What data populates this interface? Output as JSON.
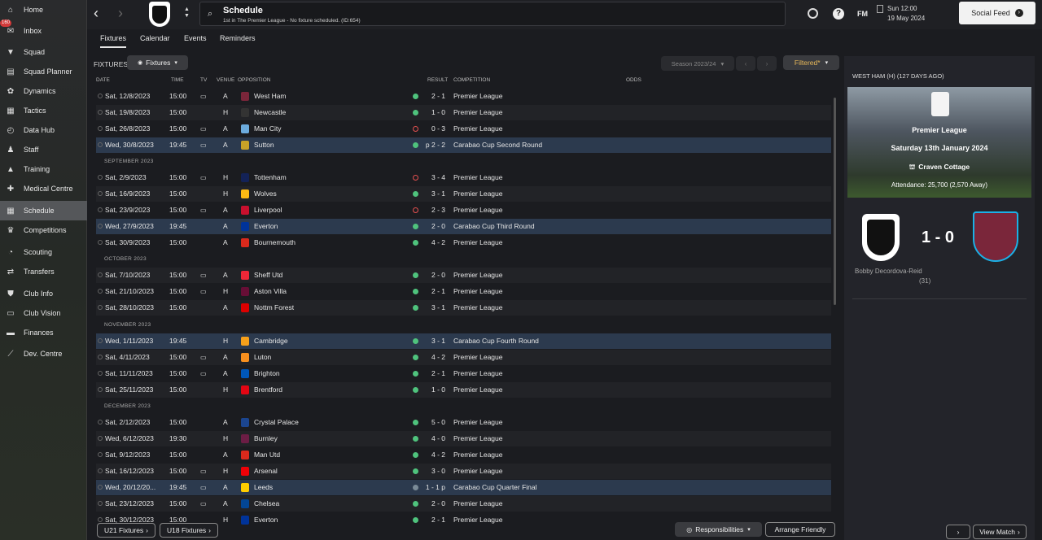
{
  "nav": [
    {
      "label": "Home",
      "icon": "home-icon"
    },
    {
      "label": "Inbox",
      "icon": "inbox-icon",
      "badge": "160"
    },
    {
      "label": "Squad",
      "icon": "shirt-icon"
    },
    {
      "label": "Squad Planner",
      "icon": "clipboard-icon"
    },
    {
      "label": "Dynamics",
      "icon": "dynamics-icon"
    },
    {
      "label": "Tactics",
      "icon": "tactics-icon"
    },
    {
      "label": "Data Hub",
      "icon": "data-hub-icon"
    },
    {
      "label": "Staff",
      "icon": "staff-icon"
    },
    {
      "label": "Training",
      "icon": "training-icon"
    },
    {
      "label": "Medical Centre",
      "icon": "medical-icon"
    },
    {
      "label": "Schedule",
      "icon": "calendar-icon",
      "active": true
    },
    {
      "label": "Competitions",
      "icon": "trophy-icon"
    },
    {
      "label": "Scouting",
      "icon": "scouting-icon"
    },
    {
      "label": "Transfers",
      "icon": "transfers-icon"
    },
    {
      "label": "Club Info",
      "icon": "shield-icon"
    },
    {
      "label": "Club Vision",
      "icon": "vision-icon"
    },
    {
      "label": "Finances",
      "icon": "finances-icon"
    },
    {
      "label": "Dev. Centre",
      "icon": "dev-centre-icon"
    }
  ],
  "header": {
    "title": "Schedule",
    "subtitle": "1st in The Premier League - No fixture scheduled. (ID:654)",
    "date": "Sun 12:00",
    "date2": "19 May 2024",
    "social_feed": "Social Feed",
    "fm_label": "FM"
  },
  "tabs": [
    "Fixtures",
    "Calendar",
    "Events",
    "Reminders"
  ],
  "toolbar": {
    "fixtures_label": "FIXTURES",
    "view_select": "Fixtures",
    "season": "Season 2023/24",
    "filter": "Filtered*"
  },
  "columns": {
    "date": "DATE",
    "time": "TIME",
    "tv": "TV",
    "venue": "VENUE",
    "opposition": "OPPOSITION",
    "result": "RESULT",
    "competition": "COMPETITION",
    "odds": "ODDS"
  },
  "months": [
    "SEPTEMBER 2023",
    "OCTOBER 2023",
    "NOVEMBER 2023",
    "DECEMBER 2023"
  ],
  "fixtures": [
    {
      "date": "Sat, 12/8/2023",
      "time": "15:00",
      "tv": true,
      "venue": "A",
      "opp": "West Ham",
      "res": "win",
      "score": "2 - 1",
      "comp": "Premier League",
      "crest": "#7a263a"
    },
    {
      "date": "Sat, 19/8/2023",
      "time": "15:00",
      "tv": false,
      "venue": "H",
      "opp": "Newcastle",
      "res": "win",
      "score": "1 - 0",
      "comp": "Premier League",
      "crest": "#333"
    },
    {
      "date": "Sat, 26/8/2023",
      "time": "15:00",
      "tv": true,
      "venue": "A",
      "opp": "Man City",
      "res": "loss",
      "score": "0 - 3",
      "comp": "Premier League",
      "crest": "#6cabdd"
    },
    {
      "date": "Wed, 30/8/2023",
      "time": "19:45",
      "tv": true,
      "venue": "A",
      "opp": "Sutton",
      "res": "win",
      "score": "p 2 - 2",
      "comp": "Carabao Cup Second Round",
      "crest": "#c9a227",
      "cup": true
    },
    {
      "date": "Sat, 2/9/2023",
      "time": "15:00",
      "tv": true,
      "venue": "H",
      "opp": "Tottenham",
      "res": "loss",
      "score": "3 - 4",
      "comp": "Premier League",
      "crest": "#132257"
    },
    {
      "date": "Sat, 16/9/2023",
      "time": "15:00",
      "tv": false,
      "venue": "H",
      "opp": "Wolves",
      "res": "win",
      "score": "3 - 1",
      "comp": "Premier League",
      "crest": "#fdb913"
    },
    {
      "date": "Sat, 23/9/2023",
      "time": "15:00",
      "tv": true,
      "venue": "A",
      "opp": "Liverpool",
      "res": "loss",
      "score": "2 - 3",
      "comp": "Premier League",
      "crest": "#c8102e"
    },
    {
      "date": "Wed, 27/9/2023",
      "time": "19:45",
      "tv": false,
      "venue": "A",
      "opp": "Everton",
      "res": "win",
      "score": "2 - 0",
      "comp": "Carabao Cup Third Round",
      "crest": "#003399",
      "cup": true
    },
    {
      "date": "Sat, 30/9/2023",
      "time": "15:00",
      "tv": false,
      "venue": "A",
      "opp": "Bournemouth",
      "res": "win",
      "score": "4 - 2",
      "comp": "Premier League",
      "crest": "#da291c"
    },
    {
      "date": "Sat, 7/10/2023",
      "time": "15:00",
      "tv": true,
      "venue": "A",
      "opp": "Sheff Utd",
      "res": "win",
      "score": "2 - 0",
      "comp": "Premier League",
      "crest": "#ee2737"
    },
    {
      "date": "Sat, 21/10/2023",
      "time": "15:00",
      "tv": true,
      "venue": "H",
      "opp": "Aston Villa",
      "res": "win",
      "score": "2 - 1",
      "comp": "Premier League",
      "crest": "#670e36"
    },
    {
      "date": "Sat, 28/10/2023",
      "time": "15:00",
      "tv": false,
      "venue": "A",
      "opp": "Nottm Forest",
      "res": "win",
      "score": "3 - 1",
      "comp": "Premier League",
      "crest": "#dd0000"
    },
    {
      "date": "Wed, 1/11/2023",
      "time": "19:45",
      "tv": false,
      "venue": "H",
      "opp": "Cambridge",
      "res": "win",
      "score": "3 - 1",
      "comp": "Carabao Cup Fourth Round",
      "crest": "#f6a01a",
      "cup": true
    },
    {
      "date": "Sat, 4/11/2023",
      "time": "15:00",
      "tv": true,
      "venue": "A",
      "opp": "Luton",
      "res": "win",
      "score": "4 - 2",
      "comp": "Premier League",
      "crest": "#f78f1e"
    },
    {
      "date": "Sat, 11/11/2023",
      "time": "15:00",
      "tv": true,
      "venue": "A",
      "opp": "Brighton",
      "res": "win",
      "score": "2 - 1",
      "comp": "Premier League",
      "crest": "#0057b8"
    },
    {
      "date": "Sat, 25/11/2023",
      "time": "15:00",
      "tv": false,
      "venue": "H",
      "opp": "Brentford",
      "res": "win",
      "score": "1 - 0",
      "comp": "Premier League",
      "crest": "#e30613"
    },
    {
      "date": "Sat, 2/12/2023",
      "time": "15:00",
      "tv": false,
      "venue": "A",
      "opp": "Crystal Palace",
      "res": "win",
      "score": "5 - 0",
      "comp": "Premier League",
      "crest": "#1b458f"
    },
    {
      "date": "Wed, 6/12/2023",
      "time": "19:30",
      "tv": false,
      "venue": "H",
      "opp": "Burnley",
      "res": "win",
      "score": "4 - 0",
      "comp": "Premier League",
      "crest": "#6c1d45"
    },
    {
      "date": "Sat, 9/12/2023",
      "time": "15:00",
      "tv": false,
      "venue": "A",
      "opp": "Man Utd",
      "res": "win",
      "score": "4 - 2",
      "comp": "Premier League",
      "crest": "#da291c"
    },
    {
      "date": "Sat, 16/12/2023",
      "time": "15:00",
      "tv": true,
      "venue": "H",
      "opp": "Arsenal",
      "res": "win",
      "score": "3 - 0",
      "comp": "Premier League",
      "crest": "#ef0107"
    },
    {
      "date": "Wed, 20/12/20...",
      "time": "19:45",
      "tv": true,
      "venue": "A",
      "opp": "Leeds",
      "res": "draw",
      "score": "1 - 1 p",
      "comp": "Carabao Cup Quarter Final",
      "crest": "#ffcd00",
      "cup": true
    },
    {
      "date": "Sat, 23/12/2023",
      "time": "15:00",
      "tv": true,
      "venue": "A",
      "opp": "Chelsea",
      "res": "win",
      "score": "2 - 0",
      "comp": "Premier League",
      "crest": "#034694"
    },
    {
      "date": "Sat, 30/12/2023",
      "time": "15:00",
      "tv": false,
      "venue": "H",
      "opp": "Everton",
      "res": "win",
      "score": "2 - 1",
      "comp": "Premier League",
      "crest": "#003399"
    }
  ],
  "footer": {
    "u21": "U21 Fixtures",
    "u18": "U18 Fixtures",
    "responsibilities": "Responsibilities",
    "arrange": "Arrange Friendly"
  },
  "panel": {
    "header": "WEST HAM (H) (127 DAYS AGO)",
    "competition": "Premier League",
    "date": "Saturday 13th January 2024",
    "venue": "Craven Cottage",
    "attendance": "Attendance: 25,700 (2,570 Away)",
    "score": "1 - 0",
    "scorer": "Bobby Decordova-Reid",
    "scorer_min": "(31)",
    "view_match": "View Match"
  }
}
